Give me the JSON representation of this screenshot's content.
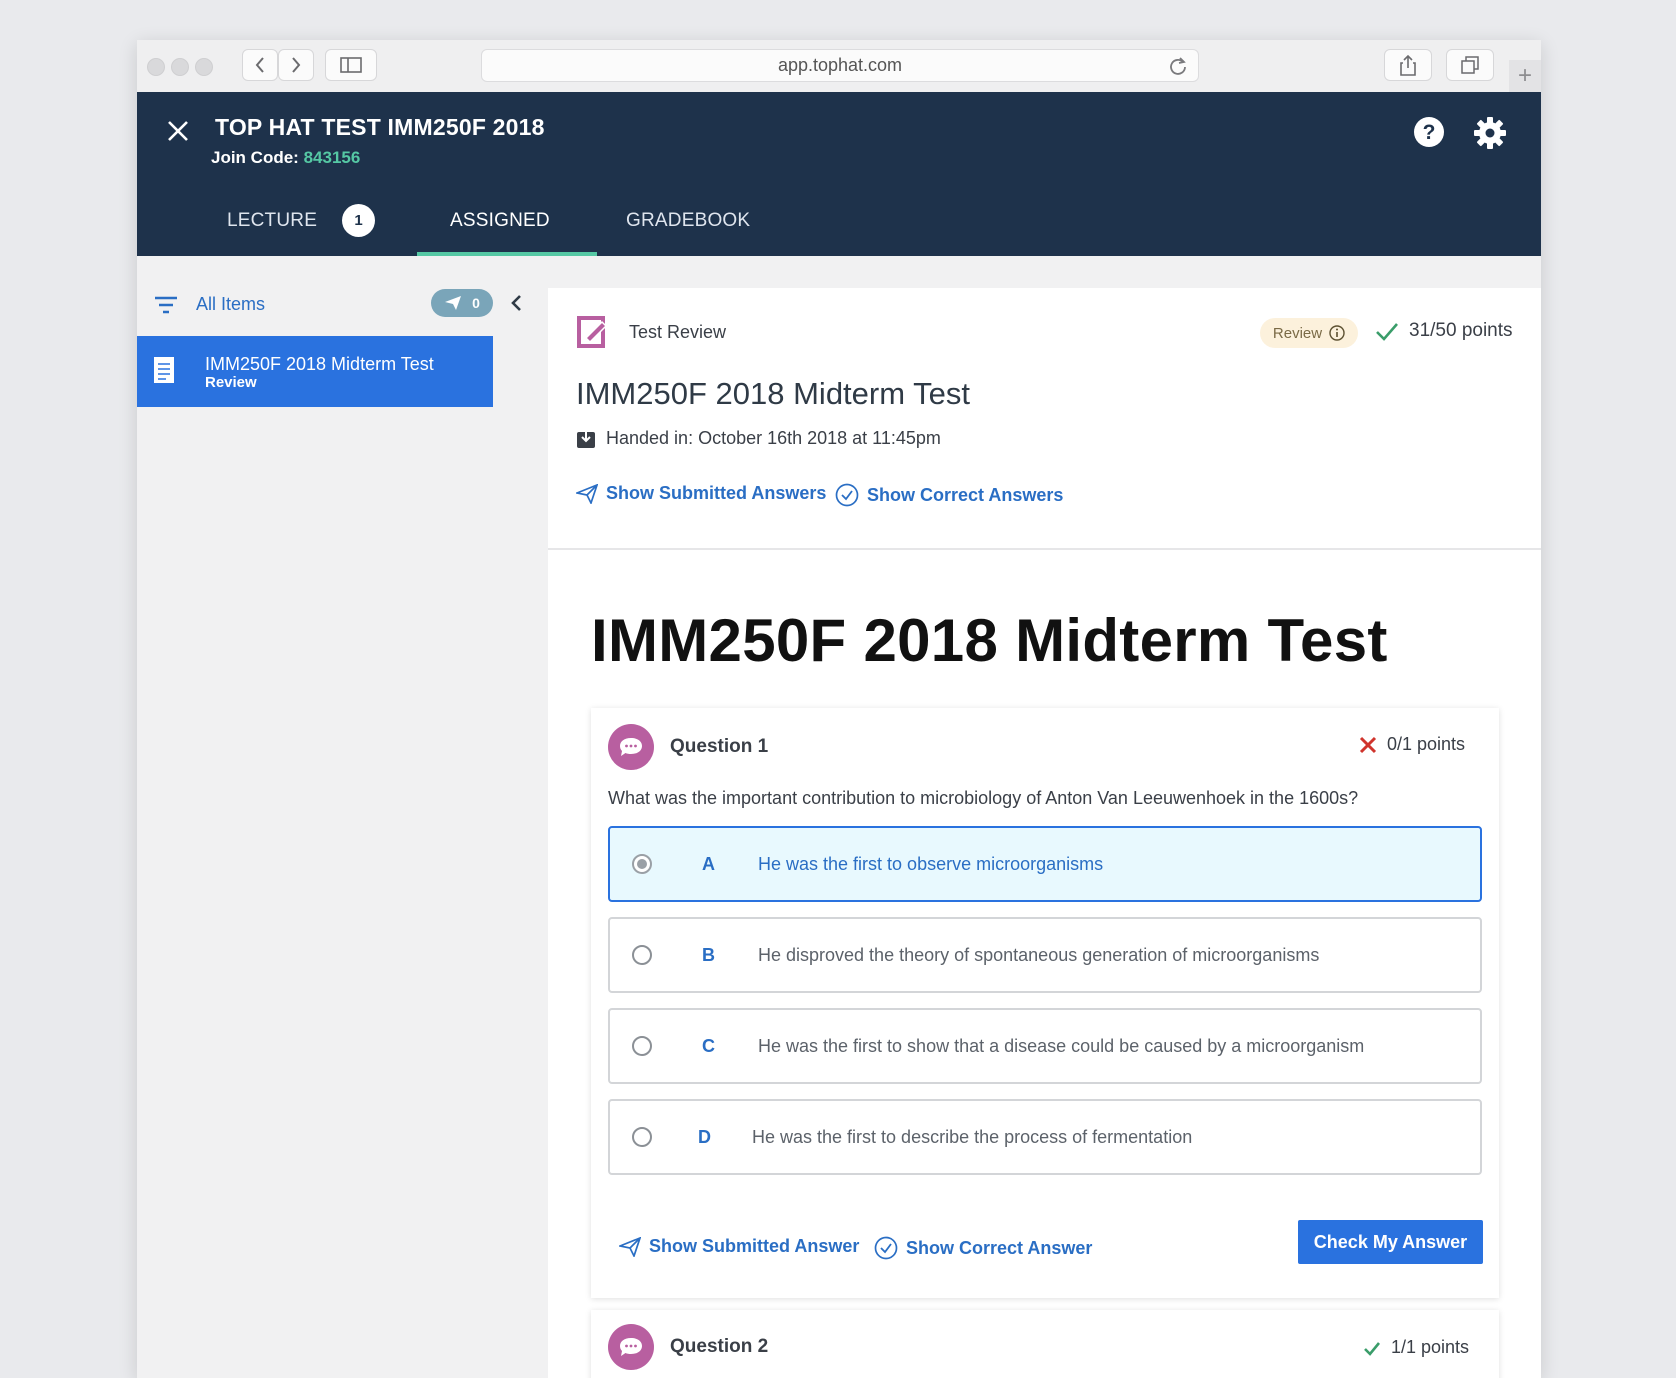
{
  "browser": {
    "url": "app.tophat.com"
  },
  "header": {
    "course_title": "TOP HAT TEST IMM250F 2018",
    "join_label": "Join Code:",
    "join_code": "843156",
    "tabs": [
      {
        "label": "LECTURE",
        "badge": "1"
      },
      {
        "label": "ASSIGNED",
        "active": true
      },
      {
        "label": "GRADEBOOK"
      }
    ],
    "accent_color": "#55c8a4",
    "bg_color": "#1e324b"
  },
  "sidebar": {
    "filter_label": "All Items",
    "submit_count": "0",
    "items": [
      {
        "title": "IMM250F 2018 Midterm Test",
        "subtitle": "Review"
      }
    ]
  },
  "review": {
    "type_label": "Test Review",
    "status_badge": "Review",
    "score": "31/50 points",
    "title": "IMM250F 2018 Midterm Test",
    "handed_in": "Handed in: October 16th 2018 at 11:45pm",
    "show_submitted": "Show Submitted Answers",
    "show_correct": "Show Correct Answers"
  },
  "test": {
    "title": "IMM250F 2018 Midterm Test",
    "questions": [
      {
        "label": "Question 1",
        "points": "0/1 points",
        "result": "incorrect",
        "text": "What was the important contribution to microbiology of Anton Van Leeuwenhoek in the 1600s?",
        "options": [
          {
            "letter": "A",
            "text": "He was the first to observe microorganisms",
            "selected": true
          },
          {
            "letter": "B",
            "text": "He disproved the theory of spontaneous generation of microorganisms"
          },
          {
            "letter": "C",
            "text": "He was the first to show that a disease could be caused by a microorganism"
          },
          {
            "letter": "D",
            "text": "He was the first to describe the process of fermentation"
          }
        ],
        "show_submitted": "Show Submitted Answer",
        "show_correct": "Show Correct Answer",
        "check_button": "Check My Answer"
      },
      {
        "label": "Question 2",
        "points": "1/1 points",
        "result": "correct"
      }
    ]
  },
  "icons": [
    "close-icon",
    "help-icon",
    "gear-icon",
    "filter-icon",
    "paper-plane-icon",
    "chevron-left-icon",
    "document-icon",
    "edit-document-icon",
    "info-icon",
    "checkmark-icon",
    "inbox-download-icon",
    "check-circle-icon",
    "chat-bubble-icon",
    "cross-icon"
  ]
}
